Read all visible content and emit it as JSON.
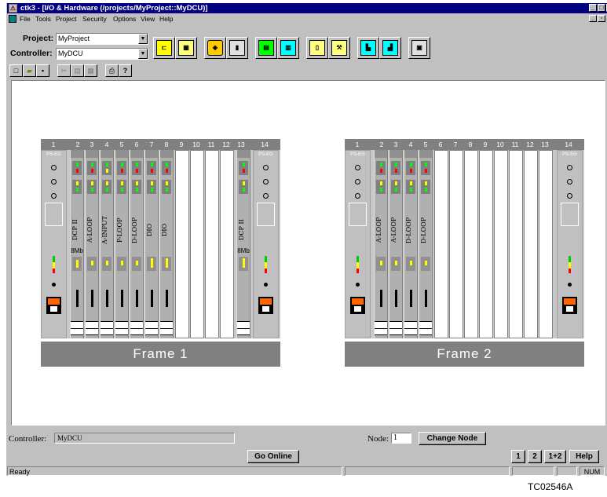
{
  "window": {
    "title": "ctk3 - [I/O & Hardware (/projects/MyProject::MyDCU)]"
  },
  "menu": {
    "items": [
      "File",
      "Tools",
      "Project",
      "Security",
      "Options",
      "View",
      "Help"
    ]
  },
  "selectors": {
    "project_label": "Project:",
    "project_value": "MyProject",
    "controller_label": "Controller:",
    "controller_value": "MyDCU"
  },
  "toolbar": {
    "icons": [
      "hierarchy-icon",
      "table-icon",
      "tag-icon",
      "hardware-icon",
      "io-list-icon",
      "network-icon",
      "function-block-icon",
      "tools-icon",
      "module-a-icon",
      "module-b-icon",
      "monitor-icon"
    ]
  },
  "std_toolbar": {
    "icons": [
      "new-icon",
      "open-icon",
      "save-icon",
      "cut-icon",
      "copy-icon",
      "paste-icon",
      "print-icon",
      "help-icon"
    ]
  },
  "frames": [
    {
      "label": "Frame 1",
      "slots": [
        "1",
        "2",
        "3",
        "4",
        "5",
        "6",
        "7",
        "8",
        "9",
        "10",
        "11",
        "12",
        "13",
        "14"
      ],
      "ps_label": "PS-EG",
      "cards": [
        "DCP II",
        "A-LOOP",
        "A-INPUT",
        "P-LOOP",
        "D-LOOP",
        "DIO",
        "DIO"
      ],
      "dcp_memory": "8Mb"
    },
    {
      "label": "Frame 2",
      "slots": [
        "1",
        "2",
        "3",
        "4",
        "5",
        "6",
        "7",
        "8",
        "9",
        "10",
        "11",
        "12",
        "13",
        "14"
      ],
      "ps_label": "PS-EG",
      "cards": [
        "A-LOOP",
        "A-LOOP",
        "D-LOOP",
        "D-LOOP"
      ]
    }
  ],
  "bottom": {
    "controller_label": "Controller:",
    "controller_value": "MyDCU",
    "node_label": "Node:",
    "node_value": "1",
    "change_node": "Change Node",
    "go_online": "Go Online",
    "view_buttons": [
      "1",
      "2",
      "1+2"
    ],
    "help": "Help"
  },
  "status": {
    "text": "Ready",
    "num": "NUM"
  },
  "caption": "TC02546A"
}
